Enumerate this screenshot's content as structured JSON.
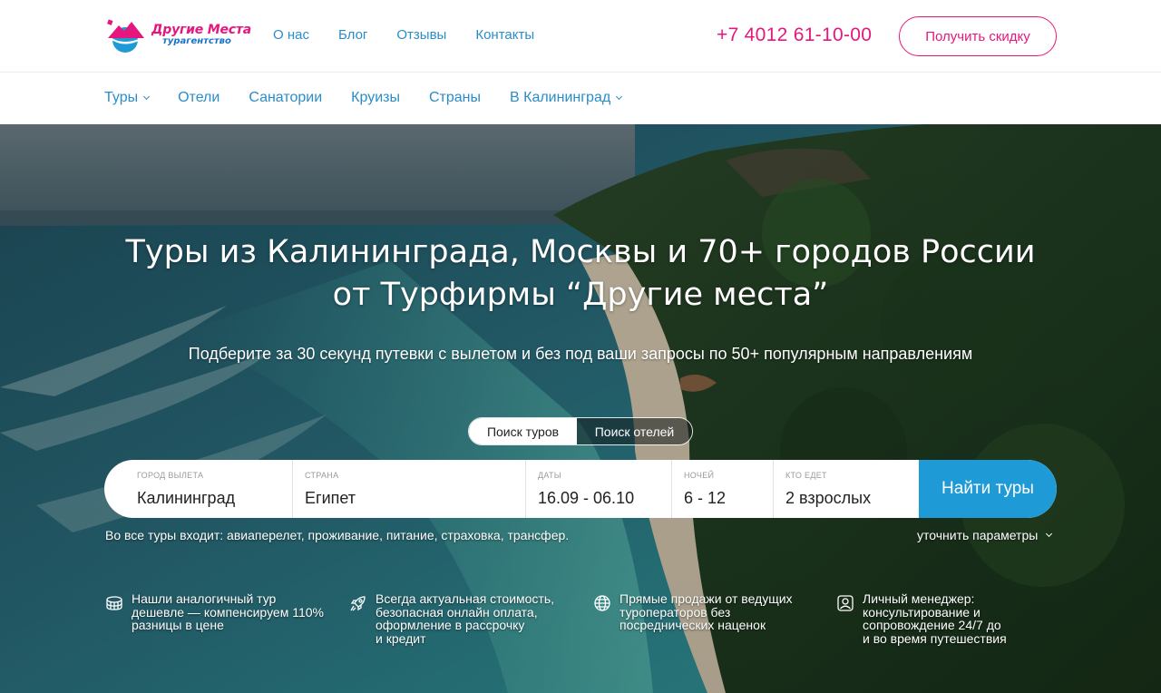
{
  "header": {
    "logo": {
      "title": "Другие Места",
      "subtitle": "турагентство"
    },
    "nav": [
      "О нас",
      "Блог",
      "Отзывы",
      "Контакты"
    ],
    "phone": "+7 4012 61-10-00",
    "discount_button": "Получить скидку"
  },
  "subnav": {
    "items": [
      {
        "label": "Туры",
        "dropdown": true
      },
      {
        "label": "Отели",
        "dropdown": false
      },
      {
        "label": "Санатории",
        "dropdown": false
      },
      {
        "label": "Круизы",
        "dropdown": false
      },
      {
        "label": "Страны",
        "dropdown": false
      },
      {
        "label": "В Калининград",
        "dropdown": true
      }
    ]
  },
  "hero": {
    "title_line1": "Туры из Калининграда, Москвы и 70+ городов России",
    "title_line2": "от Турфирмы “Другие места”",
    "subtitle": "Подберите за 30 секунд путевки с вылетом и без под ваши запросы по 50+ популярным направлениям",
    "toggle": {
      "tours": "Поиск туров",
      "hotels": "Поиск отелей",
      "active": "tours"
    }
  },
  "search": {
    "departure": {
      "label": "ГОРОД ВЫЛЕТА",
      "value": "Калининград"
    },
    "country": {
      "label": "СТРАНА",
      "value": "Египет"
    },
    "dates": {
      "label": "ДАТЫ",
      "value": "16.09 - 06.10"
    },
    "nights": {
      "label": "НОЧЕЙ",
      "value": "6 - 12"
    },
    "travelers": {
      "label": "КТО ЕДЕТ",
      "value": "2 взрослых"
    },
    "button": "Найти туры"
  },
  "includes_text": "Во все туры входит: авиаперелет, проживание, питание, страховка, трансфер.",
  "refine_link": "уточнить параметры",
  "features": [
    {
      "icon": "coins-icon",
      "text": "Нашли аналогичный тур\nдешевле — компенсируем 110%\nразницы в цене"
    },
    {
      "icon": "rocket-icon",
      "text": "Всегда актуальная стоимость,\nбезопасная онлайн оплата,\nоформление в рассрочку\nи кредит"
    },
    {
      "icon": "globe-icon",
      "text": "Прямые продажи от ведущих\nтуроператоров без\nпосреднических наценок"
    },
    {
      "icon": "manager-icon",
      "text": "Личный менеджер:\nконсультирование и\nсопровождение 24/7 до\nи во время путешествия"
    }
  ],
  "colors": {
    "accent_pink": "#e5177f",
    "link_blue": "#2b8dc8",
    "button_blue": "#1e9ad6"
  }
}
